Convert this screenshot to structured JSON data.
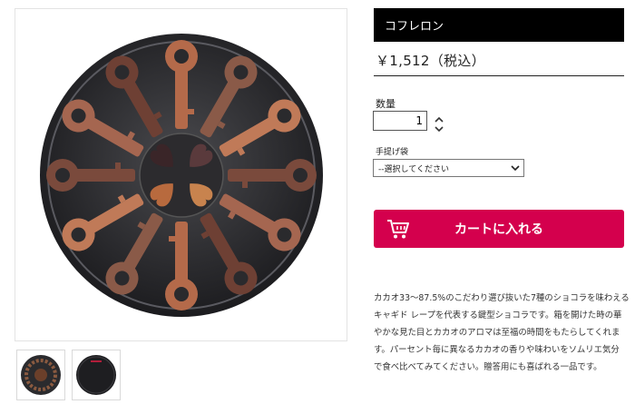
{
  "product": {
    "title": "コフレロン",
    "price": "￥1,512（税込）"
  },
  "quantity": {
    "label": "数量",
    "value": "1"
  },
  "bag": {
    "label": "手提げ袋",
    "selected": "--選択してください"
  },
  "cart": {
    "label": "カートに入れる"
  },
  "description": {
    "lines": [
      "カカオ33〜87.5%のこだわり選び抜いた7種のショコラを味わえる",
      "キャギド レープを代表する鍵型ショコラです。箱を開けた時の華",
      "やかな見た目とカカオのアロマは至福の時間をもたらしてくれま",
      "す。パーセント毎に異なるカカオの香りや味わいをソムリエ気分",
      "で食べ比べてみてください。贈答用にも喜ばれる一品です。"
    ]
  },
  "colors": {
    "accent": "#d4004d",
    "title_bar": "#000000"
  },
  "icons": {
    "cart": "cart-icon",
    "stepper_up": "chevron-up-icon",
    "stepper_down": "chevron-down-icon",
    "select": "chevron-down-icon"
  },
  "gallery": {
    "thumbnails": [
      "chocolate-box-open",
      "chocolate-box-closed"
    ]
  }
}
